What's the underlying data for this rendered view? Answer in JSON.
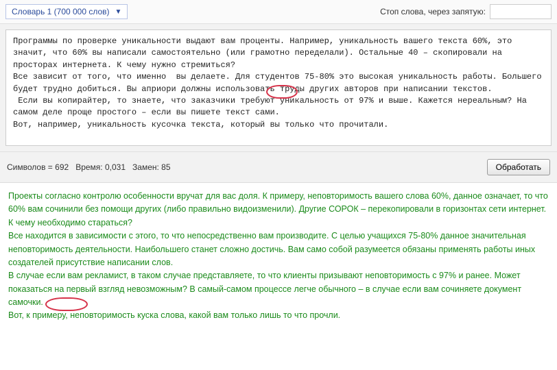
{
  "toolbar": {
    "dictionary_label": "Словарь 1 (700 000 слов)",
    "stop_label": "Стоп слова, через запятую:",
    "stop_value": ""
  },
  "input": {
    "text": "Программы по проверке уникальности выдают вам проценты. Например, уникальность вашего текста 60%, это значит, что 60% вы написали самостоятельно (или грамотно переделали). Остальные 40 – скопировали на просторах интернета. К чему нужно стремиться?\nВсе зависит от того, что именно  вы делаете. Для студентов 75-80% это высокая уникальность работы. Большего будет трудно добиться. Вы априори должны использовать труды других авторов при написании текстов.\n Если вы копирайтер, то знаете, что заказчики требуют уникальность от 97% и выше. Кажется нереальным? На самом деле проще простого – если вы пишете текст сами.\nВот, например, уникальность кусочка текста, который вы только что прочитали."
  },
  "stats": {
    "symbols_label": "Символов =",
    "symbols": "692",
    "time_label": "Время:",
    "time": "0,031",
    "replacements_label": "Замен:",
    "replacements": "85",
    "process_label": "Обработать"
  },
  "output": {
    "text": "Проекты согласно контролю особенности вручат для вас доля. К примеру, неповторимость вашего слова 60%, данное означает, то что 60% вам сочинили без помощи других (либо правильно видоизменили). Другие СОРОК – перекопировали в горизонтах сети интернет. К чему необходимо стараться?\nВсе находится в зависимости с этого, то что непосредственно вам производите. С целью учащихся 75-80% данное значительная неповторимость деятельности. Наибольшего станет сложно достичь. Вам само собой разумеется обязаны применять работы иных создателей присутствие написании слов.\nВ случае если вам рекламист, в таком случае представляете, то что клиенты призывают неповторимость с 97% и ранее. Может показаться на первый взгляд невозможным? В самый-самом процессе легче обычного – в случае если вам сочиняете документ самочки.\nВот, к примеру, неповторимость куска слова, какой вам только лишь то что прочли."
  }
}
